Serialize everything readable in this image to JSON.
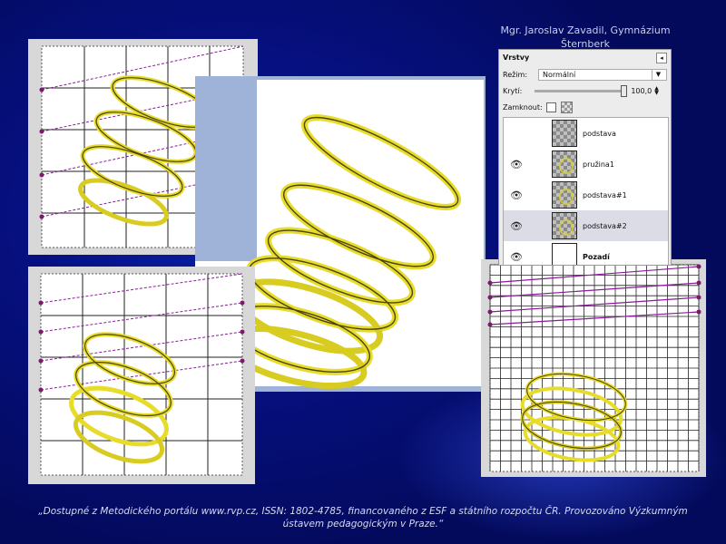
{
  "credit": {
    "line1": "Mgr. Jaroslav Zavadil, Gymnázium",
    "line2": "Šternberk"
  },
  "layers_dialog": {
    "title": "Vrstvy",
    "mode_label": "Režim:",
    "mode_value": "Normální",
    "opacity_label": "Krytí:",
    "opacity_value": "100,0",
    "lock_label": "Zamknout:",
    "layers": [
      {
        "name": "podstava",
        "visible": false,
        "active": false,
        "thumb": "checker"
      },
      {
        "name": "pružina1",
        "visible": true,
        "active": false,
        "thumb": "spring"
      },
      {
        "name": "podstava#1",
        "visible": true,
        "active": false,
        "thumb": "spring"
      },
      {
        "name": "podstava#2",
        "visible": true,
        "active": true,
        "thumb": "spring"
      },
      {
        "name": "Pozadí",
        "visible": true,
        "active": false,
        "thumb": "white"
      }
    ],
    "icons": {
      "eye": "eye-icon",
      "menu": "menu-arrow-icon",
      "chevron": "chevron-down-icon"
    }
  },
  "colors": {
    "spring": "#e7dc2a",
    "spring_dark": "#4a4410",
    "guide": "#8a1a9a",
    "accent": "#0a1fa8"
  },
  "footer": {
    "line1": "„Dostupné z Metodického portálu www.rvp.cz, ISSN: 1802-4785, financovaného z ESF a státního rozpočtu ČR. Provozováno Výzkumným",
    "line2": "ústavem pedagogickým v Praze.“"
  }
}
